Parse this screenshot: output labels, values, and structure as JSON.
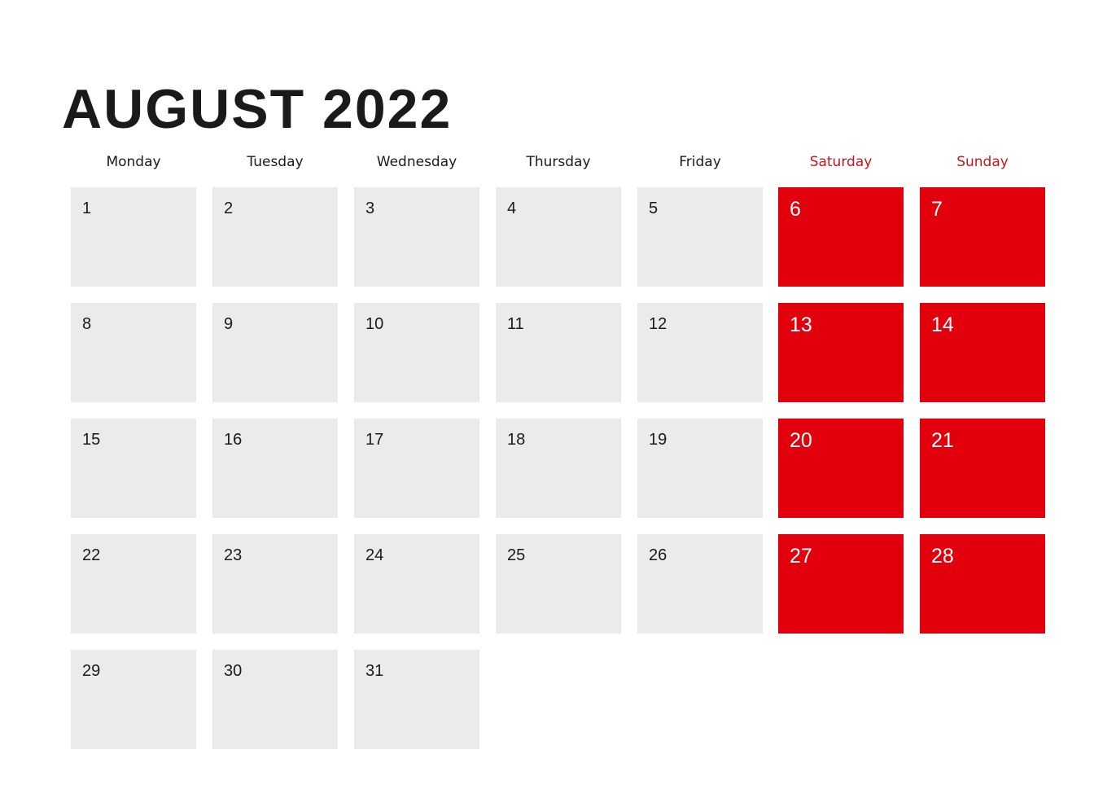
{
  "calendar": {
    "title": "AUGUST 2022",
    "weekend_color": "#e1000c",
    "weekend_header_color": "#c8141e",
    "weekday_cell_color": "#ebebeb",
    "weekdays": [
      {
        "label": "Monday",
        "weekend": false
      },
      {
        "label": "Tuesday",
        "weekend": false
      },
      {
        "label": "Wednesday",
        "weekend": false
      },
      {
        "label": "Thursday",
        "weekend": false
      },
      {
        "label": "Friday",
        "weekend": false
      },
      {
        "label": "Saturday",
        "weekend": true
      },
      {
        "label": "Sunday",
        "weekend": true
      }
    ],
    "weeks": [
      [
        "1",
        "2",
        "3",
        "4",
        "5",
        "6",
        "7"
      ],
      [
        "8",
        "9",
        "10",
        "11",
        "12",
        "13",
        "14"
      ],
      [
        "15",
        "16",
        "17",
        "18",
        "19",
        "20",
        "21"
      ],
      [
        "22",
        "23",
        "24",
        "25",
        "26",
        "27",
        "28"
      ],
      [
        "29",
        "30",
        "31"
      ]
    ]
  }
}
